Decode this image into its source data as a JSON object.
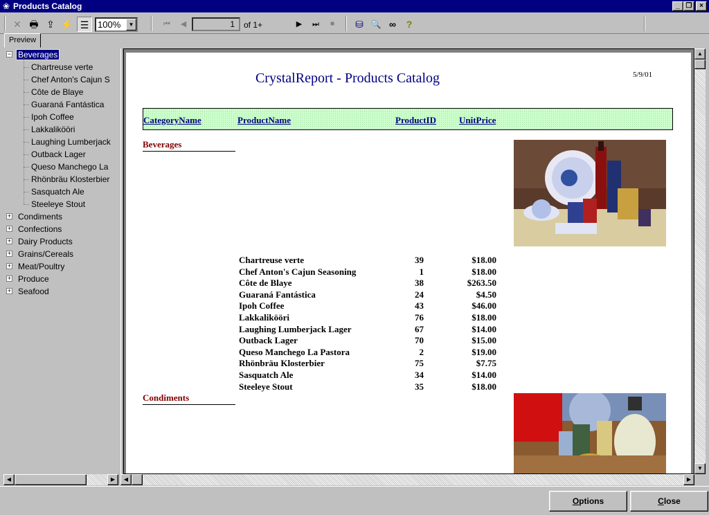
{
  "window": {
    "title": "Products Catalog",
    "minimize_glyph": "_",
    "maximize_glyph": "❐",
    "close_glyph": "×"
  },
  "toolbar": {
    "zoom": "100%",
    "page_number": "1",
    "page_of": "of 1+",
    "icons": [
      "close-view-icon",
      "print-icon",
      "export-icon",
      "refresh-icon",
      "group-tree-icon",
      "first-page-icon",
      "prev-page-icon",
      "next-page-icon",
      "last-page-icon",
      "stop-icon",
      "database-icon",
      "search-icon",
      "binoculars-icon",
      "help-icon"
    ],
    "glyphs": {
      "close_view": "✕",
      "print": "🖶",
      "export": "⇪",
      "refresh": "⚡",
      "tree": "☰",
      "first": "⏮",
      "prev": "◀",
      "next": "▶",
      "last": "⏭",
      "stop": "■",
      "database": "⛁",
      "search": "🔍",
      "find": "∞",
      "help": "?",
      "dropdown": "▼"
    }
  },
  "tabs": {
    "preview": "Preview"
  },
  "tree": {
    "root": "Beverages",
    "children": [
      "Chartreuse verte",
      "Chef Anton's Cajun S",
      "Côte de Blaye",
      "Guaraná Fantástica",
      "Ipoh Coffee",
      "Lakkalikööri",
      "Laughing Lumberjack",
      "Outback Lager",
      "Queso Manchego La",
      "Rhönbräu Klosterbier",
      "Sasquatch Ale",
      "Steeleye Stout"
    ],
    "collapsed": [
      "Condiments",
      "Confections",
      "Dairy Products",
      "Grains/Cereals",
      "Meat/Poultry",
      "Produce",
      "Seafood"
    ],
    "expanded_glyph": "−",
    "collapsed_glyph": "+"
  },
  "report": {
    "title": "CrystalReport - Products Catalog",
    "date": "5/9/01",
    "headers": {
      "category": "CategoryName",
      "product": "ProductName",
      "id": "ProductID",
      "price": "UnitPrice"
    },
    "categories": [
      {
        "name": "Beverages",
        "products": [
          {
            "name": "Chartreuse verte",
            "id": "39",
            "price": "$18.00"
          },
          {
            "name": "Chef Anton's Cajun Seasoning",
            "id": "1",
            "price": "$18.00"
          },
          {
            "name": "Côte de Blaye",
            "id": "38",
            "price": "$263.50"
          },
          {
            "name": "Guaraná Fantástica",
            "id": "24",
            "price": "$4.50"
          },
          {
            "name": "Ipoh Coffee",
            "id": "43",
            "price": "$46.00"
          },
          {
            "name": "Lakkalikööri",
            "id": "76",
            "price": "$18.00"
          },
          {
            "name": "Laughing Lumberjack Lager",
            "id": "67",
            "price": "$14.00"
          },
          {
            "name": "Outback Lager",
            "id": "70",
            "price": "$15.00"
          },
          {
            "name": "Queso Manchego La Pastora",
            "id": "2",
            "price": "$19.00"
          },
          {
            "name": "Rhönbräu Klosterbier",
            "id": "75",
            "price": "$7.75"
          },
          {
            "name": "Sasquatch Ale",
            "id": "34",
            "price": "$14.00"
          },
          {
            "name": "Steeleye Stout",
            "id": "35",
            "price": "$18.00"
          }
        ]
      },
      {
        "name": "Condiments",
        "products": []
      }
    ]
  },
  "scroll": {
    "up": "▲",
    "down": "▼",
    "left": "◀",
    "right": "▶"
  },
  "buttons": {
    "options_acc": "O",
    "options_rest": "ptions",
    "close_acc": "C",
    "close_rest": "lose"
  }
}
